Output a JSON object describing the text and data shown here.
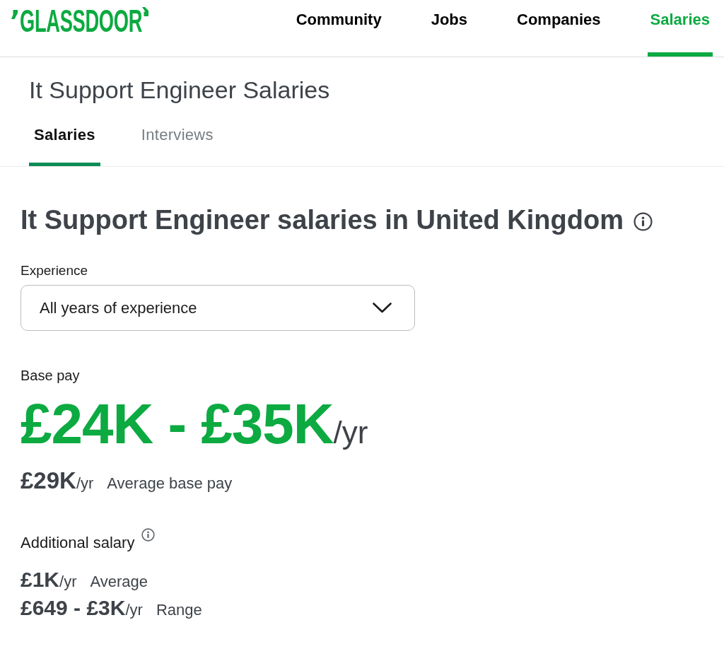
{
  "header": {
    "logo": "GLASSDOOR",
    "nav": [
      {
        "label": "Community",
        "selected": false
      },
      {
        "label": "Jobs",
        "selected": false
      },
      {
        "label": "Companies",
        "selected": false
      },
      {
        "label": "Salaries",
        "selected": true
      }
    ]
  },
  "page_title": "It Support Engineer Salaries",
  "tabs": [
    {
      "label": "Salaries",
      "selected": true
    },
    {
      "label": "Interviews",
      "selected": false
    }
  ],
  "heading": "It Support Engineer salaries in United Kingdom",
  "experience": {
    "label": "Experience",
    "value": "All years of experience"
  },
  "base_pay": {
    "label": "Base pay",
    "range": "£24K - £35K",
    "unit": "/yr",
    "average": {
      "amount": "£29K",
      "unit": "/yr",
      "label": "Average base pay"
    }
  },
  "additional_salary": {
    "label": "Additional salary",
    "rows": [
      {
        "amount": "£1K",
        "unit": "/yr",
        "label": "Average"
      },
      {
        "amount": "£649 - £3K",
        "unit": "/yr",
        "label": "Range"
      }
    ]
  }
}
